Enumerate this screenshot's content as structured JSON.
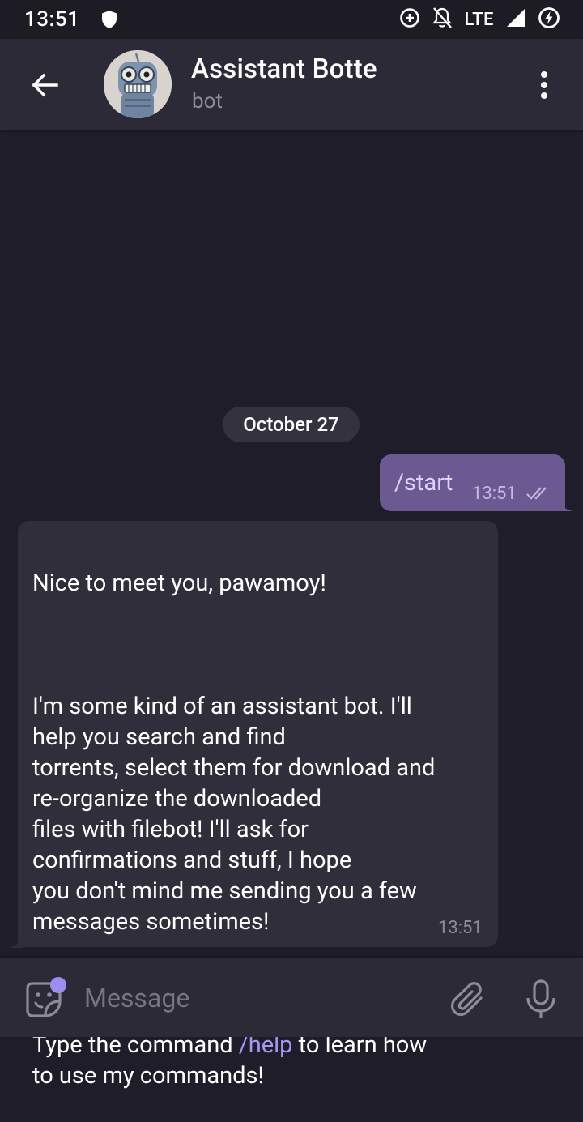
{
  "status_bar": {
    "time": "13:51",
    "network": "LTE"
  },
  "header": {
    "title": "Assistant Botte",
    "subtitle": "bot"
  },
  "chat": {
    "date_divider": "October 27",
    "outgoing": {
      "text": "/start",
      "time": "13:51"
    },
    "incoming": {
      "line1": "Nice to meet you, pawamoy!",
      "paragraph2": "I'm some kind of an assistant bot. I'll\nhelp you search and find\ntorrents, select them for download and\nre-organize the downloaded\nfiles with filebot! I'll ask for\nconfirmations and stuff, I hope\nyou don't mind me sending you a few\nmessages sometimes!",
      "p3_before": "Type the command ",
      "p3_link": "/help",
      "p3_after": " to learn how\nto use my commands!",
      "time": "13:51"
    }
  },
  "input": {
    "placeholder": "Message"
  },
  "colors": {
    "background": "#1f1d29",
    "header": "#2c2a36",
    "outgoing_bubble": "#6b5a91",
    "incoming_bubble": "#312e3b",
    "accent": "#a896f2"
  }
}
